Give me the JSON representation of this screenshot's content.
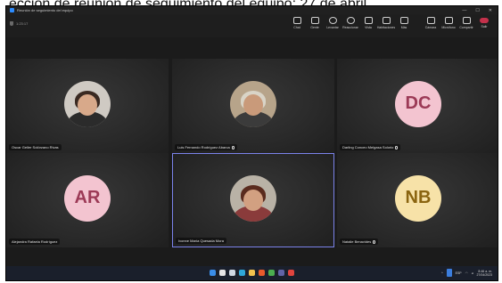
{
  "caption": "ección de reunión de seguimiento del equipo: 27 de abril",
  "window": {
    "title": "Reunión de seguimiento del equipo",
    "controls": [
      "—",
      "☐",
      "✕"
    ]
  },
  "toolbar": {
    "meeting_time": "1:23:17",
    "items": [
      {
        "icon": "chat-icon",
        "label": "Chat"
      },
      {
        "icon": "people-icon",
        "label": "Gente"
      },
      {
        "icon": "raise-hand-icon",
        "label": "Levantar"
      },
      {
        "icon": "reactions-icon",
        "label": "Reaccionar"
      },
      {
        "icon": "view-icon",
        "label": "Vista"
      },
      {
        "icon": "rooms-icon",
        "label": "Habitaciones"
      },
      {
        "icon": "more-icon",
        "label": "Más"
      },
      {
        "icon": "camera-icon",
        "label": "Cámara"
      },
      {
        "icon": "microphone-icon",
        "label": "Micrófono"
      },
      {
        "icon": "share-icon",
        "label": "Compartir"
      },
      {
        "icon": "leave-icon",
        "label": "Salir"
      }
    ]
  },
  "participants": [
    {
      "name": "Oscar Geiler Solórzano Rivas",
      "avatar": "photo",
      "photo_style": "woman-short-hair",
      "muted": false,
      "active": false
    },
    {
      "name": "Luis Fernando Rodríguez Abarca",
      "avatar": "photo",
      "photo_style": "man-cap",
      "muted": true,
      "active": false
    },
    {
      "name": "Darling Conceo Melgasa Solorio",
      "avatar": "initials",
      "initials": "DC",
      "color": "#f3c4d0",
      "muted": true,
      "active": false
    },
    {
      "name": "Alejandra Rafaela Rodríguez",
      "avatar": "initials",
      "initials": "AR",
      "color": "#f3c4d0",
      "muted": false,
      "active": false
    },
    {
      "name": "Ivonne María Quesada Mora",
      "avatar": "photo",
      "photo_style": "woman-long-hair",
      "muted": false,
      "active": true
    },
    {
      "name": "Natalie Benavides",
      "avatar": "initials",
      "initials": "NB",
      "color": "#f7e2a8",
      "muted": true,
      "active": false
    }
  ],
  "taskbar": {
    "apps": [
      {
        "icon": "windows-start-icon",
        "color": "#3b8eea"
      },
      {
        "icon": "search-icon",
        "color": "#e5e5e5"
      },
      {
        "icon": "task-view-icon",
        "color": "#cfd8e3"
      },
      {
        "icon": "edge-icon",
        "color": "#2fa7d8"
      },
      {
        "icon": "file-explorer-icon",
        "color": "#f2c14e"
      },
      {
        "icon": "store-icon",
        "color": "#e85a2c"
      },
      {
        "icon": "chrome-icon",
        "color": "#4caf50"
      },
      {
        "icon": "teams-icon",
        "color": "#6264a7"
      },
      {
        "icon": "mail-icon",
        "color": "#e0443e"
      }
    ],
    "language": "ESP",
    "time": "8:46 a. m.",
    "date": "27/04/2023"
  }
}
